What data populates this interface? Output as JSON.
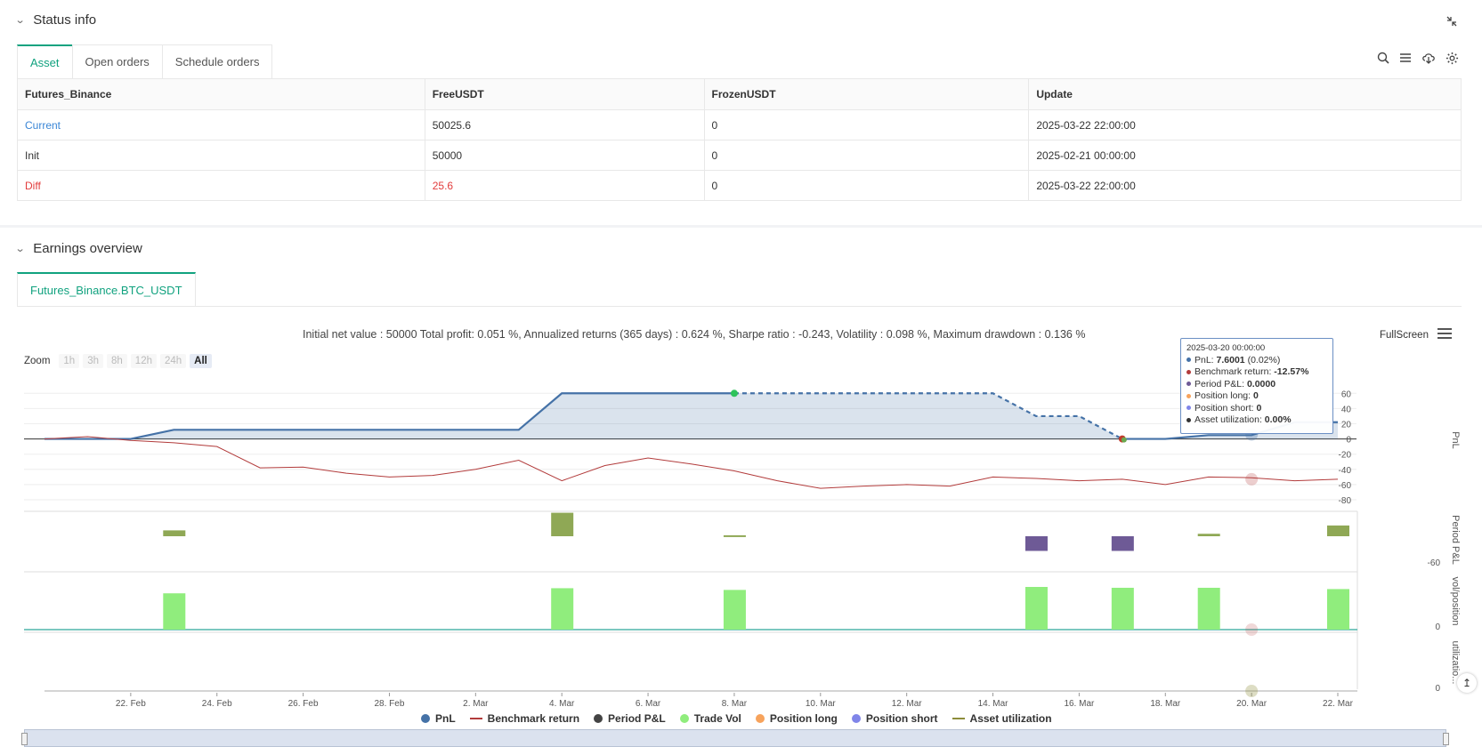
{
  "status": {
    "title": "Status info",
    "tabs": [
      "Asset",
      "Open orders",
      "Schedule orders"
    ],
    "table": {
      "headers": [
        "Futures_Binance",
        "FreeUSDT",
        "FrozenUSDT",
        "Update"
      ],
      "rows": [
        [
          "Current",
          "50025.6",
          "0",
          "2025-03-22 22:00:00"
        ],
        [
          "Init",
          "50000",
          "0",
          "2025-02-21 00:00:00"
        ],
        [
          "Diff",
          "25.6",
          "0",
          "2025-03-22 22:00:00"
        ]
      ]
    }
  },
  "earnings": {
    "title": "Earnings overview",
    "tab": "Futures_Binance.BTC_USDT",
    "summary": "Initial net value : 50000 Total profit: 0.051 %, Annualized returns (365 days) : 0.624 %, Sharpe ratio : -0.243, Volatility : 0.098 %, Maximum drawdown : 0.136 %",
    "zoom_label": "Zoom",
    "zoom_buttons": [
      "1h",
      "3h",
      "8h",
      "12h",
      "24h",
      "All"
    ],
    "fullscreen": "FullScreen",
    "tooltip": {
      "date": "2025-03-20 00:00:00",
      "pnl_label": "PnL: ",
      "pnl_value": "7.6001",
      "pnl_pct": " (0.02%)",
      "bench_label": "Benchmark return: ",
      "bench_value": "-12.57%",
      "period_label": "Period P&L: ",
      "period_value": "0.0000",
      "long_label": "Position long: ",
      "long_value": "0",
      "short_label": "Position short: ",
      "short_value": "0",
      "util_label": "Asset utilization: ",
      "util_value": "0.00%"
    },
    "legend": [
      {
        "label": "PnL",
        "color": "#4572a7",
        "kind": "dot"
      },
      {
        "label": "Benchmark return",
        "color": "#b23b3b",
        "kind": "line"
      },
      {
        "label": "Period P&L",
        "color": "#444444",
        "kind": "dot"
      },
      {
        "label": "Trade Vol",
        "color": "#90ed7d",
        "kind": "dot"
      },
      {
        "label": "Position long",
        "color": "#f7a35c",
        "kind": "dot"
      },
      {
        "label": "Position short",
        "color": "#8085e9",
        "kind": "dot"
      },
      {
        "label": "Asset utilization",
        "color": "#8d8d3a",
        "kind": "line"
      }
    ]
  },
  "chart_data": {
    "type": "line",
    "x_ticks": [
      "22. Feb",
      "24. Feb",
      "26. Feb",
      "28. Feb",
      "2. Mar",
      "4. Mar",
      "6. Mar",
      "8. Mar",
      "10. Mar",
      "12. Mar",
      "14. Mar",
      "16. Mar",
      "18. Mar",
      "20. Mar",
      "22. Mar"
    ],
    "pnl_yticks": [
      60,
      40,
      20,
      0,
      -20,
      -40,
      -60,
      -80
    ],
    "pnl_ylim": [
      -80,
      65
    ],
    "pnl_axis_title": "PnL",
    "period_axis_title": "Period P&L",
    "period_yticks": [
      -60
    ],
    "vol_axis_title": "vol/position",
    "vol_yticks": [
      0
    ],
    "util_axis_title": "utilizatio...",
    "util_yticks": [
      0
    ],
    "pnl_series": {
      "name": "PnL",
      "points": [
        [
          0,
          0
        ],
        [
          2,
          0
        ],
        [
          3,
          12
        ],
        [
          6,
          12
        ],
        [
          10,
          12
        ],
        [
          11,
          12
        ],
        [
          12,
          60
        ],
        [
          16,
          60
        ],
        [
          18,
          60
        ],
        [
          22,
          60
        ],
        [
          23,
          30
        ],
        [
          24,
          30
        ],
        [
          25,
          0
        ],
        [
          26,
          0
        ],
        [
          27,
          5
        ],
        [
          28,
          5
        ],
        [
          29,
          22
        ],
        [
          30,
          22
        ]
      ],
      "dashed_from": 16,
      "dashed_to": 25
    },
    "benchmark_series": {
      "name": "Benchmark return",
      "points": [
        [
          0,
          0
        ],
        [
          1,
          3
        ],
        [
          2,
          -2
        ],
        [
          3,
          -5
        ],
        [
          4,
          -10
        ],
        [
          5,
          -38
        ],
        [
          6,
          -37
        ],
        [
          7,
          -45
        ],
        [
          8,
          -50
        ],
        [
          9,
          -48
        ],
        [
          10,
          -40
        ],
        [
          11,
          -28
        ],
        [
          12,
          -55
        ],
        [
          13,
          -35
        ],
        [
          14,
          -25
        ],
        [
          15,
          -33
        ],
        [
          16,
          -42
        ],
        [
          17,
          -55
        ],
        [
          18,
          -65
        ],
        [
          19,
          -62
        ],
        [
          20,
          -60
        ],
        [
          21,
          -62
        ],
        [
          22,
          -50
        ],
        [
          23,
          -52
        ],
        [
          24,
          -55
        ],
        [
          25,
          -53
        ],
        [
          26,
          -60
        ],
        [
          27,
          -50
        ],
        [
          28,
          -51
        ],
        [
          29,
          -55
        ],
        [
          30,
          -53
        ]
      ]
    },
    "period_pnl_bars": [
      {
        "x": 3,
        "value": 12,
        "color": "#8fa855"
      },
      {
        "x": 12,
        "value": 48,
        "color": "#8fa855"
      },
      {
        "x": 16,
        "value": 2,
        "color": "#8fa855"
      },
      {
        "x": 23,
        "value": -30,
        "color": "#6e5a96"
      },
      {
        "x": 25,
        "value": -30,
        "color": "#6e5a96"
      },
      {
        "x": 27,
        "value": 5,
        "color": "#8fa855"
      },
      {
        "x": 30,
        "value": 22,
        "color": "#8fa855"
      }
    ],
    "trade_vol_bars": [
      {
        "x": 3,
        "value": 0.85
      },
      {
        "x": 12,
        "value": 0.97
      },
      {
        "x": 16,
        "value": 0.93
      },
      {
        "x": 23,
        "value": 1.0
      },
      {
        "x": 25,
        "value": 0.98
      },
      {
        "x": 27,
        "value": 0.98
      },
      {
        "x": 30,
        "value": 0.95
      }
    ],
    "x_count": 31
  }
}
